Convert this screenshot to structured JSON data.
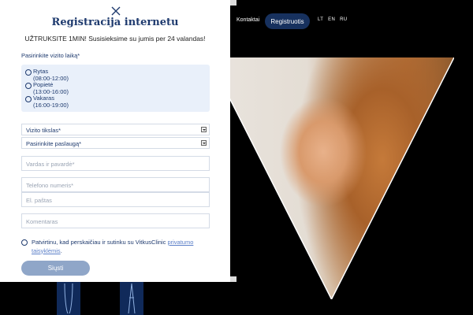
{
  "background": {
    "nav_link": "Kontaktai",
    "register_button": "Registruotis",
    "languages": [
      "LT",
      "EN",
      "RU"
    ]
  },
  "modal": {
    "title": "Registracija internetu",
    "subtitle": "UŽTRUKSITE 1MIN! Susisieksime su jumis per 24 valandas!",
    "time_label": "Pasirinkite vizito laiką*",
    "time_options": [
      {
        "label": "Rytas",
        "range": "(08:00-12:00)"
      },
      {
        "label": "Popietė",
        "range": "(13:00-16:00)"
      },
      {
        "label": "Vakaras",
        "range": "(16:00-19:00)"
      }
    ],
    "purpose_select": "Vizito tikslas*",
    "service_select": "Pasirinkite paslaugą*",
    "name_placeholder": "Vardas ir pavardė*",
    "phone_placeholder": "Telefono numeris*",
    "email_placeholder": "El. paštas",
    "comment_placeholder": "Komentaras",
    "consent_text": "Patvirtinu, kad perskaičiau ir sutinku su VitkusClinic ",
    "consent_link": "privatumo taisyklėmis",
    "consent_end": ".",
    "submit": "Siųsti"
  },
  "colors": {
    "navy": "#1e3a6e",
    "button_navy": "#17315e",
    "submit_bg": "#8fa6c8",
    "option_box": "#e9f0fa"
  }
}
